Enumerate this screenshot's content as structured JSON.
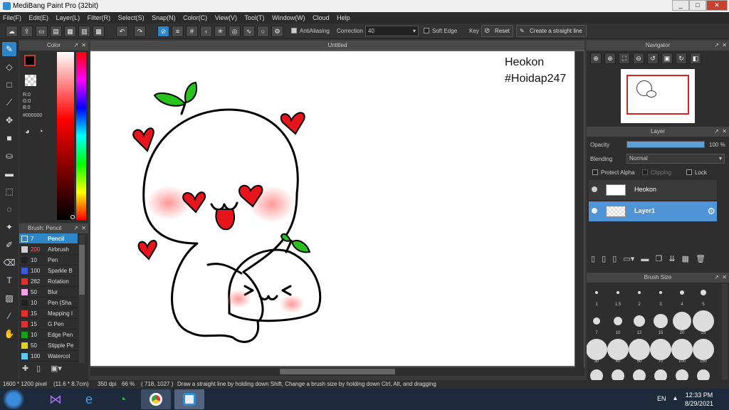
{
  "window": {
    "title": "MediBang Paint Pro (32bit)",
    "controls": [
      "_",
      "□",
      "✕"
    ]
  },
  "menu": [
    "File(F)",
    "Edit(E)",
    "Layer(L)",
    "Filter(R)",
    "Select(S)",
    "Snap(N)",
    "Color(C)",
    "View(V)",
    "Tool(T)",
    "Window(W)",
    "Cloud",
    "Help"
  ],
  "toolbar": {
    "antialias_label": "AntiAliasing",
    "correction_label": "Correction",
    "correction_value": "40",
    "soft_edge_label": "Soft Edge",
    "key_label": "Key",
    "reset_label": "Reset",
    "straight_line_label": "Create a straight line"
  },
  "color_panel": {
    "title": "Color",
    "r": "R:0",
    "g": "G:0",
    "b": "B:0",
    "hex": "#000000"
  },
  "brush_panel": {
    "title": "Brush: Pencil",
    "items": [
      {
        "size": "7",
        "name": "Pencil",
        "color": "#2e86c9"
      },
      {
        "size": "200",
        "name": "Airbrush",
        "color": "#cfcfcf"
      },
      {
        "size": "10",
        "name": "Pen",
        "color": "#222222"
      },
      {
        "size": "100",
        "name": "Sparkle B",
        "color": "#3a5bd8"
      },
      {
        "size": "282",
        "name": "Rotation",
        "color": "#e03030"
      },
      {
        "size": "50",
        "name": "Blur",
        "color": "#f2a3e8"
      },
      {
        "size": "10",
        "name": "Pen (Sha",
        "color": "#222222"
      },
      {
        "size": "15",
        "name": "Mapping I",
        "color": "#e03030"
      },
      {
        "size": "15",
        "name": "G Pen",
        "color": "#e03030"
      },
      {
        "size": "10",
        "name": "Edge Pen",
        "color": "#18a018"
      },
      {
        "size": "50",
        "name": "Stipple Pe",
        "color": "#e0d020"
      },
      {
        "size": "100",
        "name": "Watercol",
        "color": "#5ec8f0"
      }
    ]
  },
  "document": {
    "tab": "Untitled",
    "watermark_line1": "Heokon",
    "watermark_line2": "#Hoidap247"
  },
  "navigator": {
    "title": "Navigator"
  },
  "layer_panel": {
    "title": "Layer",
    "opacity_label": "Opacity",
    "opacity_value": "100 %",
    "opacity_fraction": 1.0,
    "blending_label": "Blending",
    "blending_value": "Normal",
    "protect_alpha": "Protect Alpha",
    "clipping": "Clipping",
    "lock": "Lock",
    "layers": [
      {
        "name": "Heokon",
        "selected": false
      },
      {
        "name": "Layer1",
        "selected": true
      }
    ]
  },
  "brush_size_panel": {
    "title": "Brush Size",
    "sizes": [
      "1",
      "1.5",
      "2",
      "3",
      "4",
      "5",
      "7",
      "10",
      "12",
      "15",
      "20",
      "25",
      "30",
      "40",
      "50",
      "70",
      "100",
      "150"
    ]
  },
  "status": {
    "dimensions": "1600 * 1200 pixel",
    "physical": "(11.6 * 8.7cm)",
    "dpi": "350 dpi",
    "zoom": "66 %",
    "coords": "( 718, 1027 )",
    "hint": "Draw a straight line by holding down Shift, Change a brush size by holding down Ctrl, Alt, and dragging"
  },
  "taskbar": {
    "lang": "EN",
    "time": "12:33 PM",
    "date": "8/29/2021"
  },
  "colors": {
    "accent": "#2e86c9",
    "heart_red": "#e8141b",
    "leaf_green": "#27c21e",
    "blush": "#ff9a9a"
  }
}
